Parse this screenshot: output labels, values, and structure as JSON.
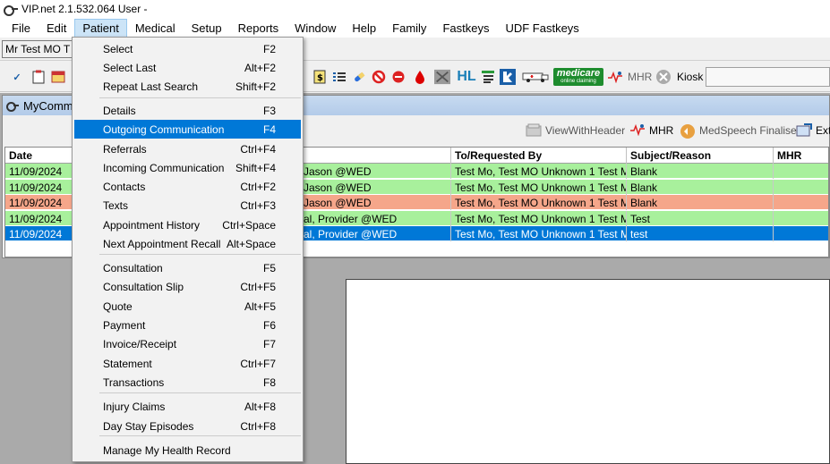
{
  "window": {
    "title": "VIP.net 2.1.532.064  User -"
  },
  "menubar": [
    {
      "label": "File"
    },
    {
      "label": "Edit"
    },
    {
      "label": "Patient"
    },
    {
      "label": "Medical"
    },
    {
      "label": "Setup"
    },
    {
      "label": "Reports"
    },
    {
      "label": "Window"
    },
    {
      "label": "Help"
    },
    {
      "label": "Family"
    },
    {
      "label": "Fastkeys"
    },
    {
      "label": "UDF Fastkeys"
    }
  ],
  "patientbar": {
    "patient_name": "Mr Test MO T"
  },
  "toolbar": {
    "mhr_label": "MHR",
    "kiosk_label": "Kiosk",
    "medicare_logo": "medicare",
    "medicare_sub": "online claiming"
  },
  "child_window": {
    "title": "MyComm",
    "buttons": {
      "view_with_header": "ViewWithHeader",
      "mhr": "MHR",
      "medspeech": "MedSpeech Finalise",
      "ext": "Ext"
    }
  },
  "grid": {
    "columns": {
      "date": "Date",
      "to": "To/Requested By",
      "subject": "Subject/Reason",
      "mhr": "MHR"
    },
    "rows": [
      {
        "date": "11/09/2024",
        "from": "Jason @WED",
        "to": "Test Mo, Test MO  Unknown 1 Test M...",
        "subject": "Blank",
        "color": "#a8f09c"
      },
      {
        "date": "11/09/2024",
        "from": "Jason @WED",
        "to": "Test Mo, Test MO  Unknown 1 Test M...",
        "subject": "Blank",
        "color": "#a8f09c"
      },
      {
        "date": "11/09/2024",
        "from": "Jason @WED",
        "to": "Test Mo, Test MO  Unknown 1 Test M...",
        "subject": "Blank",
        "color": "#f5a68a"
      },
      {
        "date": "11/09/2024",
        "from": "al, Provider @WED",
        "to": "Test Mo, Test MO  Unknown 1 Test M...",
        "subject": "Test",
        "color": "#a8f09c"
      },
      {
        "date": "11/09/2024",
        "from": "al, Provider @WED",
        "to": "Test Mo, Test MO  Unknown 1 Test M...",
        "subject": "test",
        "color": "#0078d7"
      }
    ]
  },
  "patient_menu": {
    "items": [
      {
        "label": "Select",
        "shortcut": "F2"
      },
      {
        "label": "Select Last",
        "shortcut": "Alt+F2"
      },
      {
        "label": "Repeat Last Search",
        "shortcut": "Shift+F2"
      },
      {
        "label": "Details",
        "shortcut": "F3"
      },
      {
        "label": "Outgoing Communication",
        "shortcut": "F4"
      },
      {
        "label": "Referrals",
        "shortcut": "Ctrl+F4"
      },
      {
        "label": "Incoming Communication",
        "shortcut": "Shift+F4"
      },
      {
        "label": "Contacts",
        "shortcut": "Ctrl+F2"
      },
      {
        "label": "Texts",
        "shortcut": "Ctrl+F3"
      },
      {
        "label": "Appointment History",
        "shortcut": "Ctrl+Space"
      },
      {
        "label": "Next Appointment Recall",
        "shortcut": "Alt+Space"
      },
      {
        "label": "Consultation",
        "shortcut": "F5"
      },
      {
        "label": "Consultation Slip",
        "shortcut": "Ctrl+F5"
      },
      {
        "label": "Quote",
        "shortcut": "Alt+F5"
      },
      {
        "label": "Payment",
        "shortcut": "F6"
      },
      {
        "label": "Invoice/Receipt",
        "shortcut": "F7"
      },
      {
        "label": "Statement",
        "shortcut": "Ctrl+F7"
      },
      {
        "label": "Transactions",
        "shortcut": "F8"
      },
      {
        "label": "Injury Claims",
        "shortcut": "Alt+F8"
      },
      {
        "label": "Day Stay Episodes",
        "shortcut": "Ctrl+F8"
      },
      {
        "label": "Manage My Health Record",
        "shortcut": ""
      }
    ],
    "highlighted": "Outgoing Communication"
  }
}
